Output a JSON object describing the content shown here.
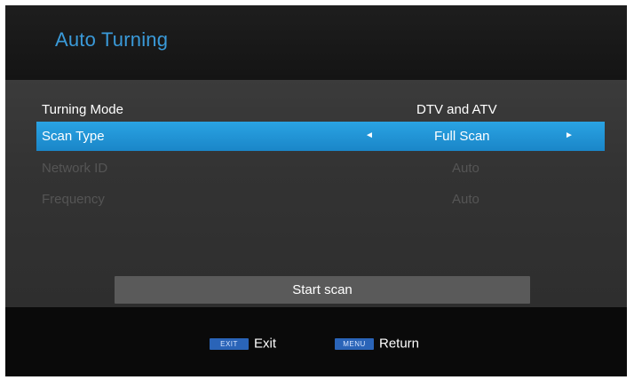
{
  "header": {
    "title": "Auto Turning"
  },
  "settings": {
    "turning_mode": {
      "label": "Turning Mode",
      "value": "DTV and ATV"
    },
    "scan_type": {
      "label": "Scan Type",
      "value": "Full Scan"
    },
    "network_id": {
      "label": "Network ID",
      "value": "Auto"
    },
    "frequency": {
      "label": "Frequency",
      "value": "Auto"
    }
  },
  "actions": {
    "start_scan": "Start scan"
  },
  "footer": {
    "exit": {
      "key": "EXIT",
      "label": "Exit"
    },
    "return": {
      "key": "MENU",
      "label": "Return"
    }
  },
  "colors": {
    "accent": "#1f95d8",
    "title": "#3a9ad9",
    "key_badge": "#2a64b8",
    "disabled_text": "#555555"
  }
}
